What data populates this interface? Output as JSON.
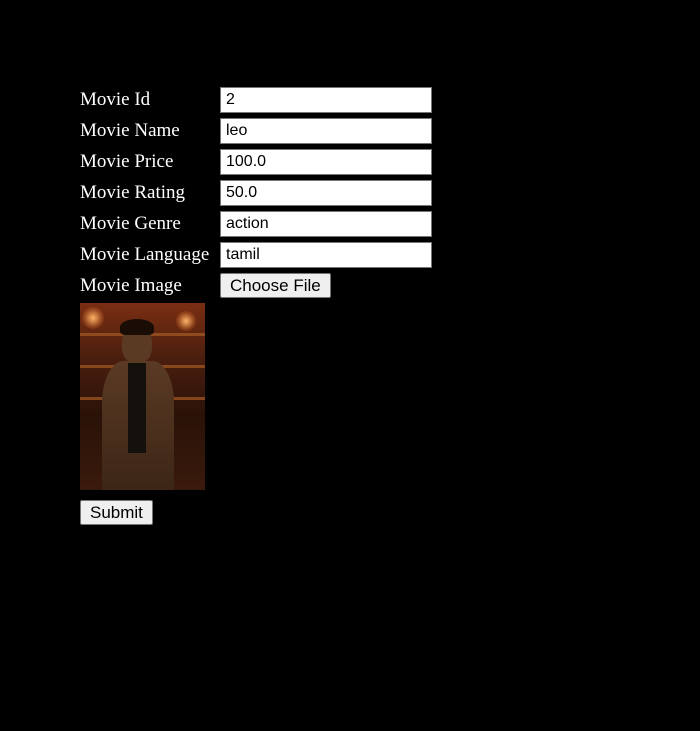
{
  "form": {
    "fields": [
      {
        "label": "Movie Id",
        "value": "2"
      },
      {
        "label": "Movie Name",
        "value": "leo"
      },
      {
        "label": "Movie Price",
        "value": "100.0"
      },
      {
        "label": "Movie Rating",
        "value": "50.0"
      },
      {
        "label": "Movie Genre",
        "value": "action"
      },
      {
        "label": "Movie Language",
        "value": "tamil"
      }
    ],
    "image_label": "Movie Image",
    "choose_file_label": "Choose File",
    "submit_label": "Submit"
  },
  "colors": {
    "background": "#000000",
    "label_text": "#ffffff",
    "input_background": "#ffffff",
    "button_background": "#efefef"
  }
}
